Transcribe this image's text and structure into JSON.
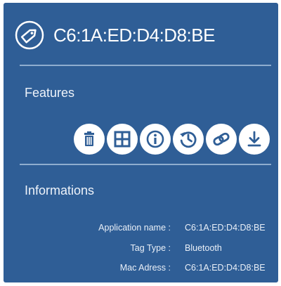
{
  "device": {
    "title": "C6:1A:ED:D4:D8:BE",
    "icon": "tag-icon"
  },
  "features": {
    "heading": "Features",
    "actions": [
      {
        "icon": "trash-icon"
      },
      {
        "icon": "grid-icon"
      },
      {
        "icon": "info-icon"
      },
      {
        "icon": "history-icon"
      },
      {
        "icon": "link-icon"
      },
      {
        "icon": "download-icon"
      }
    ]
  },
  "informations": {
    "heading": "Informations",
    "rows": [
      {
        "key": "Application name :",
        "value": "C6:1A:ED:D4:D8:BE"
      },
      {
        "key": "Tag Type :",
        "value": "Bluetooth"
      },
      {
        "key": "Mac Adress :",
        "value": "C6:1A:ED:D4:D8:BE"
      }
    ]
  },
  "colors": {
    "background": "#2f5e96",
    "divider": "#8fadcf",
    "button": "#ffffff"
  }
}
